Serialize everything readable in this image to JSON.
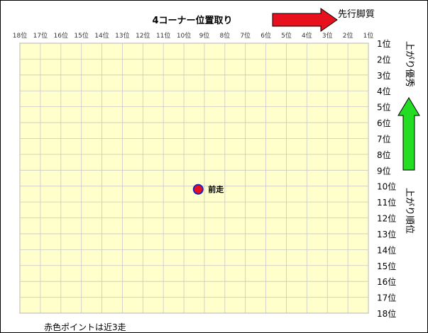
{
  "chart_data": {
    "type": "scatter",
    "title": "4コーナー位置取り",
    "x_axis_label": "先行脚質",
    "y_axis_label_top": "上がり優秀",
    "y_axis_label_right": "上がり順位",
    "x_ticks": [
      "18位",
      "17位",
      "16位",
      "15位",
      "14位",
      "13位",
      "12位",
      "11位",
      "10位",
      "9位",
      "8位",
      "7位",
      "6位",
      "5位",
      "4位",
      "3位",
      "2位",
      "1位"
    ],
    "y_ticks": [
      "1位",
      "2位",
      "3位",
      "4位",
      "5位",
      "6位",
      "7位",
      "8位",
      "9位",
      "10位",
      "11位",
      "12位",
      "13位",
      "14位",
      "15位",
      "16位",
      "17位",
      "18位"
    ],
    "xlim": [
      18,
      1
    ],
    "ylim": [
      1,
      18
    ],
    "grid": true,
    "background_color": "#FFFFCC",
    "grid_color": "#C8C8C8",
    "points": [
      {
        "label": "前走",
        "x": 9.3,
        "y": 10.2,
        "fill": "#E8101C",
        "stroke": "#2020C0"
      }
    ],
    "footnote": "赤色ポイントは近3走",
    "arrow_right_color": "#E8101C",
    "arrow_up_color": "#22DD22"
  }
}
